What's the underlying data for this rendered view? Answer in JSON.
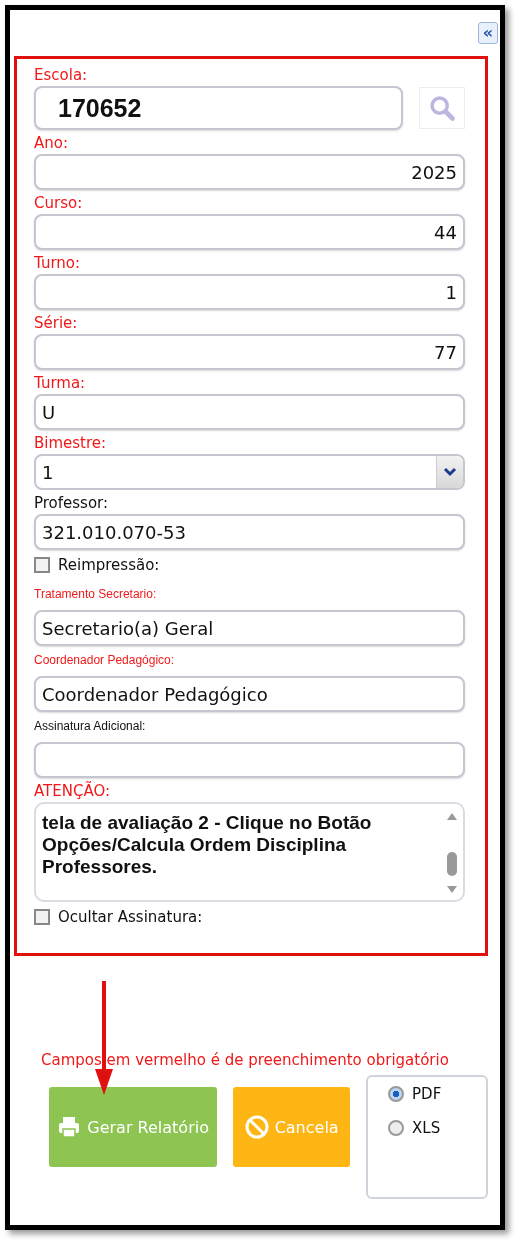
{
  "collapse_button": {
    "label": "«"
  },
  "form": {
    "fields": [
      {
        "kind": "lookup",
        "label": "Escola:",
        "required": true,
        "value": "170652"
      },
      {
        "kind": "number",
        "label": "Ano:",
        "required": true,
        "value": "2025"
      },
      {
        "kind": "number",
        "label": "Curso:",
        "required": true,
        "value": "44"
      },
      {
        "kind": "number",
        "label": "Turno:",
        "required": true,
        "value": "1"
      },
      {
        "kind": "number",
        "label": "Série:",
        "required": true,
        "value": "77"
      },
      {
        "kind": "text",
        "label": "Turma:",
        "required": true,
        "value": "U"
      },
      {
        "kind": "select",
        "label": "Bimestre:",
        "required": true,
        "value": "1"
      },
      {
        "kind": "text",
        "label": "Professor:",
        "required": false,
        "value": "321.010.070-53"
      },
      {
        "kind": "checkbox",
        "label": "Reimpressão:",
        "checked": false
      },
      {
        "kind": "text_small",
        "label": "Tratamento Secretario:",
        "required": true,
        "value": "Secretario(a) Geral"
      },
      {
        "kind": "text_small",
        "label": "Coordenador Pedagógico:",
        "required": true,
        "value": "Coordenador Pedagógico"
      },
      {
        "kind": "text_small",
        "label": "Assinatura Adicional:",
        "required": false
      },
      {
        "kind": "textarea",
        "label": "ATENÇÃO:",
        "required": true,
        "value": "tela de avaliação  2 - Clique no Botão Opções/Calcula Ordem Disciplina Professores."
      },
      {
        "kind": "checkbox",
        "label": "Ocultar Assinatura:",
        "checked": false
      }
    ]
  },
  "required_note": "Campos em vermelho é de preenchimento obrigatório",
  "buttons": [
    {
      "kind": "generate",
      "label": "Gerar Relatório"
    },
    {
      "kind": "cancel",
      "label": "Cancela"
    }
  ],
  "format_options": [
    {
      "label": "PDF",
      "selected": true
    },
    {
      "label": "XLS",
      "selected": false
    }
  ]
}
